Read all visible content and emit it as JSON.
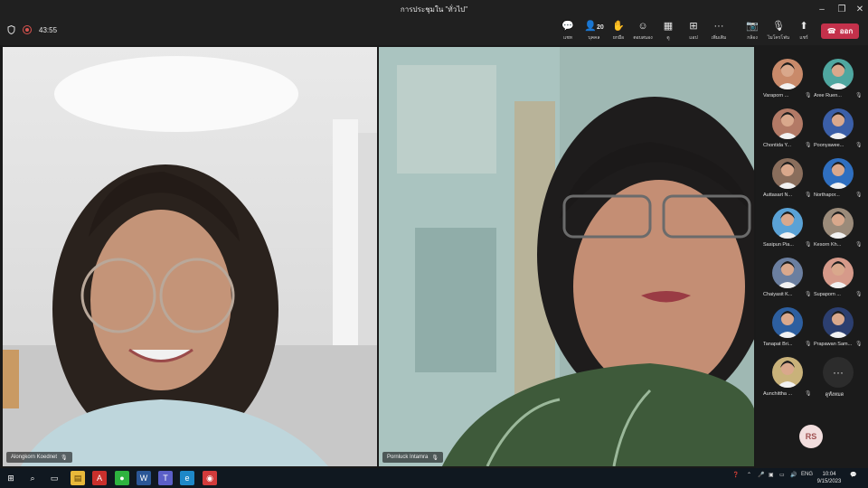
{
  "window": {
    "title": "การประชุมใน \"ทั่วไป\"",
    "minimize": "–",
    "maximize": "❐",
    "close": "✕"
  },
  "toolbar": {
    "timer": "43:55",
    "chat": "แชท",
    "people_count": "20",
    "people": "บุคคล",
    "raise": "ยกมือ",
    "react": "ตอบสนอง",
    "view": "ดู",
    "apps": "แอป",
    "more": "เพิ่มเติม",
    "camera": "กล้อง",
    "mic": "ไมโครโฟน",
    "share": "แชร์",
    "leave": "ออก"
  },
  "stage": {
    "tiles": [
      {
        "name": "Alongkorn Koednet"
      },
      {
        "name": "Pornluck Intamra"
      }
    ]
  },
  "gallery": {
    "participants": [
      {
        "name": "Varaporn ...",
        "color": "#c98a6a"
      },
      {
        "name": "Aree Ruen...",
        "color": "#4fa7a0"
      },
      {
        "name": "Chontida Y...",
        "color": "#b37a66"
      },
      {
        "name": "Poonyawee...",
        "color": "#3b5fa8"
      },
      {
        "name": "Auttasart N...",
        "color": "#8a6e5c"
      },
      {
        "name": "Northapor...",
        "color": "#2f6fc0"
      },
      {
        "name": "Sasipun Pia...",
        "color": "#5aa2d6"
      },
      {
        "name": "Kesorn Kh...",
        "color": "#9b8b7a"
      },
      {
        "name": "Chaiyasit K...",
        "color": "#6b7fa0"
      },
      {
        "name": "Supaporn ...",
        "color": "#d69a8a"
      },
      {
        "name": "Tanapat Bri...",
        "color": "#2d5fa0"
      },
      {
        "name": "Prapawan Sam...",
        "color": "#2c3f70"
      },
      {
        "name": "Aunchittha ...",
        "color": "#c9b27a"
      }
    ],
    "more_label": "ดูทั้งหมด",
    "self_initials": "RS"
  },
  "taskbar": {
    "lang": "ENG",
    "time": "10:04",
    "date": "9/15/2023"
  }
}
